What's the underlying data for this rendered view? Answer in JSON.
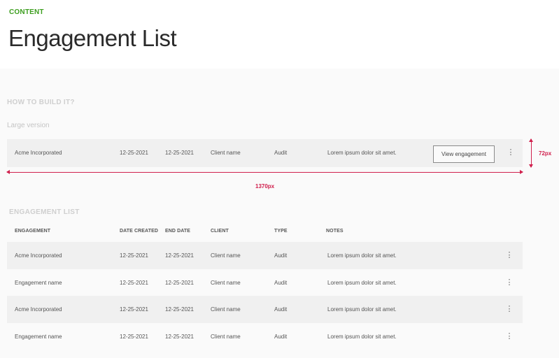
{
  "eyebrow": "CONTENT",
  "title": "Engagement List",
  "how_to": {
    "heading": "HOW TO BUILD IT?",
    "subtitle": "Large version",
    "sample_row": {
      "name": "Acme Incorporated",
      "date_created": "12-25-2021",
      "end_date": "12-25-2021",
      "client": "Client name",
      "type": "Audit",
      "notes": "Lorem ipsum dolor sit amet.",
      "button_label": "View engagement"
    },
    "height_label": "72px",
    "width_label": "1370px"
  },
  "list": {
    "heading": "ENGAGEMENT LIST",
    "columns": [
      "ENGAGEMENT",
      "DATE CREATED",
      "END DATE",
      "CLIENT",
      "TYPE",
      "NOTES"
    ],
    "rows": [
      {
        "name": "Acme Incorporated",
        "date_created": "12-25-2021",
        "end_date": "12-25-2021",
        "client": "Client name",
        "type": "Audit",
        "notes": "Lorem ipsum dolor sit amet."
      },
      {
        "name": "Engagement name",
        "date_created": "12-25-2021",
        "end_date": "12-25-2021",
        "client": "Client name",
        "type": "Audit",
        "notes": "Lorem ipsum dolor sit amet."
      },
      {
        "name": "Acme Incorporated",
        "date_created": "12-25-2021",
        "end_date": "12-25-2021",
        "client": "Client name",
        "type": "Audit",
        "notes": "Lorem ipsum dolor sit amet."
      },
      {
        "name": "Engagement name",
        "date_created": "12-25-2021",
        "end_date": "12-25-2021",
        "client": "Client name",
        "type": "Audit",
        "notes": "Lorem ipsum dolor sit amet."
      }
    ]
  },
  "icons": {
    "row_menu": "kebab-menu-icon"
  },
  "colors": {
    "accent": "#3d9e1f",
    "measure": "#d0204d",
    "row_alt": "#f0f0f0"
  }
}
